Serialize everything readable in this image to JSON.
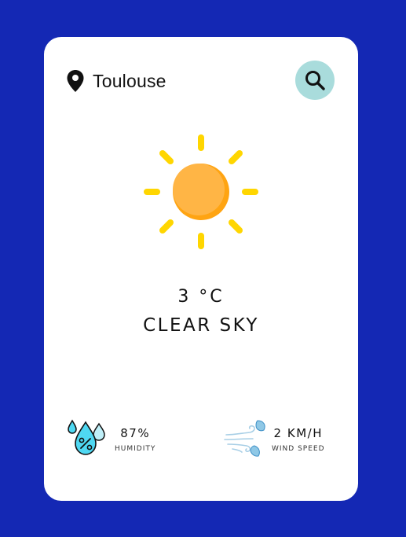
{
  "location": {
    "city": "Toulouse",
    "icon": "map-pin-icon"
  },
  "search": {
    "icon": "search-icon",
    "accent": "#a9dcdc"
  },
  "weather": {
    "icon": "sun-icon",
    "temperature": "3 °C",
    "condition": "CLEAR SKY"
  },
  "stats": {
    "humidity": {
      "value": "87%",
      "label": "HUMIDITY",
      "icon": "humidity-drops-icon"
    },
    "wind": {
      "value": "2 KM/H",
      "label": "WIND SPEED",
      "icon": "wind-leaves-icon"
    }
  },
  "colors": {
    "background": "#1428b4",
    "card": "#ffffff",
    "sun": "#ffb240",
    "sun_rays": "#ffd600"
  }
}
